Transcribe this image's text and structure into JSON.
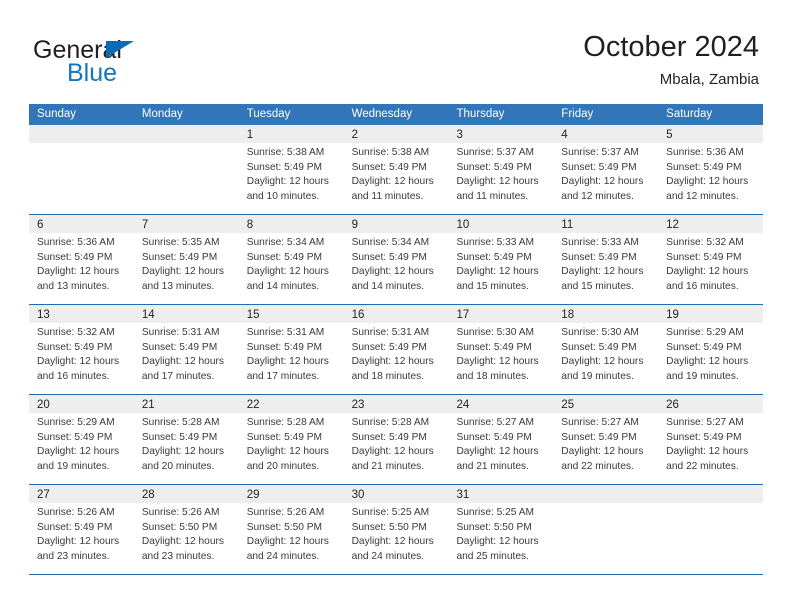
{
  "brand": {
    "word1": "General",
    "word2": "Blue",
    "flag_color": "#0b6cb5",
    "word2_color": "#1175bf"
  },
  "header": {
    "title": "October 2024",
    "subtitle": "Mbala, Zambia"
  },
  "theme": {
    "header_blue": "#3275b8",
    "rule_blue": "#1f6cb0",
    "daystrip_gray": "#eeeeee",
    "text": "#231f20"
  },
  "calendar": {
    "weekday_headers": [
      "Sunday",
      "Monday",
      "Tuesday",
      "Wednesday",
      "Thursday",
      "Friday",
      "Saturday"
    ],
    "weeks": [
      [
        {
          "day": "",
          "lines": []
        },
        {
          "day": "",
          "lines": []
        },
        {
          "day": "1",
          "lines": [
            "Sunrise: 5:38 AM",
            "Sunset: 5:49 PM",
            "Daylight: 12 hours",
            "and 10 minutes."
          ]
        },
        {
          "day": "2",
          "lines": [
            "Sunrise: 5:38 AM",
            "Sunset: 5:49 PM",
            "Daylight: 12 hours",
            "and 11 minutes."
          ]
        },
        {
          "day": "3",
          "lines": [
            "Sunrise: 5:37 AM",
            "Sunset: 5:49 PM",
            "Daylight: 12 hours",
            "and 11 minutes."
          ]
        },
        {
          "day": "4",
          "lines": [
            "Sunrise: 5:37 AM",
            "Sunset: 5:49 PM",
            "Daylight: 12 hours",
            "and 12 minutes."
          ]
        },
        {
          "day": "5",
          "lines": [
            "Sunrise: 5:36 AM",
            "Sunset: 5:49 PM",
            "Daylight: 12 hours",
            "and 12 minutes."
          ]
        }
      ],
      [
        {
          "day": "6",
          "lines": [
            "Sunrise: 5:36 AM",
            "Sunset: 5:49 PM",
            "Daylight: 12 hours",
            "and 13 minutes."
          ]
        },
        {
          "day": "7",
          "lines": [
            "Sunrise: 5:35 AM",
            "Sunset: 5:49 PM",
            "Daylight: 12 hours",
            "and 13 minutes."
          ]
        },
        {
          "day": "8",
          "lines": [
            "Sunrise: 5:34 AM",
            "Sunset: 5:49 PM",
            "Daylight: 12 hours",
            "and 14 minutes."
          ]
        },
        {
          "day": "9",
          "lines": [
            "Sunrise: 5:34 AM",
            "Sunset: 5:49 PM",
            "Daylight: 12 hours",
            "and 14 minutes."
          ]
        },
        {
          "day": "10",
          "lines": [
            "Sunrise: 5:33 AM",
            "Sunset: 5:49 PM",
            "Daylight: 12 hours",
            "and 15 minutes."
          ]
        },
        {
          "day": "11",
          "lines": [
            "Sunrise: 5:33 AM",
            "Sunset: 5:49 PM",
            "Daylight: 12 hours",
            "and 15 minutes."
          ]
        },
        {
          "day": "12",
          "lines": [
            "Sunrise: 5:32 AM",
            "Sunset: 5:49 PM",
            "Daylight: 12 hours",
            "and 16 minutes."
          ]
        }
      ],
      [
        {
          "day": "13",
          "lines": [
            "Sunrise: 5:32 AM",
            "Sunset: 5:49 PM",
            "Daylight: 12 hours",
            "and 16 minutes."
          ]
        },
        {
          "day": "14",
          "lines": [
            "Sunrise: 5:31 AM",
            "Sunset: 5:49 PM",
            "Daylight: 12 hours",
            "and 17 minutes."
          ]
        },
        {
          "day": "15",
          "lines": [
            "Sunrise: 5:31 AM",
            "Sunset: 5:49 PM",
            "Daylight: 12 hours",
            "and 17 minutes."
          ]
        },
        {
          "day": "16",
          "lines": [
            "Sunrise: 5:31 AM",
            "Sunset: 5:49 PM",
            "Daylight: 12 hours",
            "and 18 minutes."
          ]
        },
        {
          "day": "17",
          "lines": [
            "Sunrise: 5:30 AM",
            "Sunset: 5:49 PM",
            "Daylight: 12 hours",
            "and 18 minutes."
          ]
        },
        {
          "day": "18",
          "lines": [
            "Sunrise: 5:30 AM",
            "Sunset: 5:49 PM",
            "Daylight: 12 hours",
            "and 19 minutes."
          ]
        },
        {
          "day": "19",
          "lines": [
            "Sunrise: 5:29 AM",
            "Sunset: 5:49 PM",
            "Daylight: 12 hours",
            "and 19 minutes."
          ]
        }
      ],
      [
        {
          "day": "20",
          "lines": [
            "Sunrise: 5:29 AM",
            "Sunset: 5:49 PM",
            "Daylight: 12 hours",
            "and 19 minutes."
          ]
        },
        {
          "day": "21",
          "lines": [
            "Sunrise: 5:28 AM",
            "Sunset: 5:49 PM",
            "Daylight: 12 hours",
            "and 20 minutes."
          ]
        },
        {
          "day": "22",
          "lines": [
            "Sunrise: 5:28 AM",
            "Sunset: 5:49 PM",
            "Daylight: 12 hours",
            "and 20 minutes."
          ]
        },
        {
          "day": "23",
          "lines": [
            "Sunrise: 5:28 AM",
            "Sunset: 5:49 PM",
            "Daylight: 12 hours",
            "and 21 minutes."
          ]
        },
        {
          "day": "24",
          "lines": [
            "Sunrise: 5:27 AM",
            "Sunset: 5:49 PM",
            "Daylight: 12 hours",
            "and 21 minutes."
          ]
        },
        {
          "day": "25",
          "lines": [
            "Sunrise: 5:27 AM",
            "Sunset: 5:49 PM",
            "Daylight: 12 hours",
            "and 22 minutes."
          ]
        },
        {
          "day": "26",
          "lines": [
            "Sunrise: 5:27 AM",
            "Sunset: 5:49 PM",
            "Daylight: 12 hours",
            "and 22 minutes."
          ]
        }
      ],
      [
        {
          "day": "27",
          "lines": [
            "Sunrise: 5:26 AM",
            "Sunset: 5:49 PM",
            "Daylight: 12 hours",
            "and 23 minutes."
          ]
        },
        {
          "day": "28",
          "lines": [
            "Sunrise: 5:26 AM",
            "Sunset: 5:50 PM",
            "Daylight: 12 hours",
            "and 23 minutes."
          ]
        },
        {
          "day": "29",
          "lines": [
            "Sunrise: 5:26 AM",
            "Sunset: 5:50 PM",
            "Daylight: 12 hours",
            "and 24 minutes."
          ]
        },
        {
          "day": "30",
          "lines": [
            "Sunrise: 5:25 AM",
            "Sunset: 5:50 PM",
            "Daylight: 12 hours",
            "and 24 minutes."
          ]
        },
        {
          "day": "31",
          "lines": [
            "Sunrise: 5:25 AM",
            "Sunset: 5:50 PM",
            "Daylight: 12 hours",
            "and 25 minutes."
          ]
        },
        {
          "day": "",
          "lines": []
        },
        {
          "day": "",
          "lines": []
        }
      ]
    ]
  }
}
